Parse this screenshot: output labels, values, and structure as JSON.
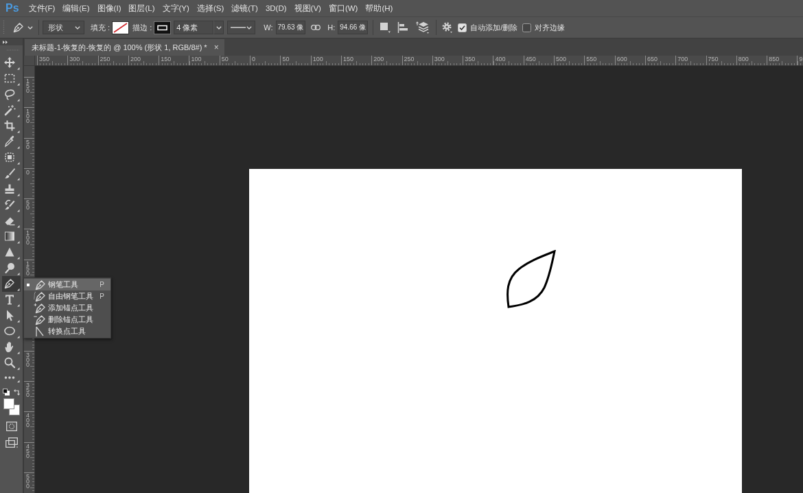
{
  "app": {
    "logo": "Ps"
  },
  "menu": [
    "文件(F)",
    "编辑(E)",
    "图像(I)",
    "图层(L)",
    "文字(Y)",
    "选择(S)",
    "滤镜(T)",
    "3D(D)",
    "视图(V)",
    "窗口(W)",
    "帮助(H)"
  ],
  "options_bar": {
    "mode": "形状",
    "fill_label": "填充 :",
    "stroke_label": "描边 :",
    "stroke_width": "4 像素",
    "width_label": "W:",
    "width_value": "79.63 像",
    "height_label": "H:",
    "height_value": "94.66 像",
    "options": [
      {
        "label": "自动添加/删除",
        "checked": true
      },
      {
        "label": "对齐边缘",
        "checked": false
      }
    ]
  },
  "document_tab": {
    "title": "未标题-1-恢复的-恢复的 @ 100% (形状 1, RGB/8#) *",
    "close": "×"
  },
  "horizontal_ruler": {
    "labels": [
      "350",
      "300",
      "250",
      "200",
      "150",
      "100",
      "50",
      "0",
      "50",
      "100",
      "150",
      "200",
      "250",
      "300",
      "350",
      "400",
      "450",
      "500",
      "550",
      "600",
      "650",
      "700",
      "750",
      "800",
      "850",
      "9"
    ]
  },
  "vertical_ruler": {
    "labels_above_flyout": [
      "150",
      "100",
      "50",
      "0",
      "50",
      "100",
      "150"
    ],
    "labels_below_flyout": [
      "300",
      "350",
      "400",
      "450",
      "500"
    ]
  },
  "toolbar": {
    "tools": [
      {
        "selected": false
      },
      {
        "selected": false
      },
      {
        "selected": false
      },
      {
        "selected": false
      },
      {
        "selected": false
      },
      {
        "selected": false
      },
      {
        "selected": false
      },
      {
        "selected": false
      },
      {
        "selected": false
      },
      {
        "selected": false
      },
      {
        "selected": false
      },
      {
        "selected": false
      },
      {
        "selected": false
      },
      {
        "selected": false
      },
      {
        "selected": true
      },
      {
        "selected": false
      },
      {
        "selected": false
      },
      {
        "selected": false
      },
      {
        "selected": false
      },
      {
        "selected": false
      },
      {
        "selected": false
      }
    ]
  },
  "tool_flyout": {
    "items": [
      {
        "label": "钢笔工具",
        "shortcut": "P",
        "selected": true
      },
      {
        "label": "自由钢笔工具",
        "shortcut": "P",
        "selected": false
      },
      {
        "label": "添加锚点工具",
        "selected": false
      },
      {
        "label": "删除锚点工具",
        "selected": false
      },
      {
        "label": "转换点工具",
        "selected": false
      }
    ]
  }
}
